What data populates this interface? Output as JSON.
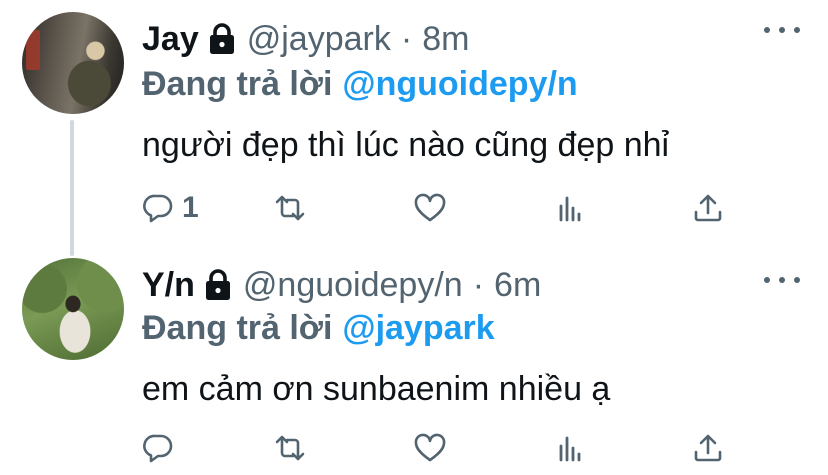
{
  "colors": {
    "text": "#0f1419",
    "secondary": "#536471",
    "accent": "#1d9bf0",
    "thread_line": "#cfd9de"
  },
  "tweets": [
    {
      "display_name": "Jay",
      "handle": "@jaypark",
      "dot": "·",
      "time": "8m",
      "reply_label": "Đang trả lời",
      "reply_to": "@nguoidepy/n",
      "text": "người đẹp thì lúc nào cũng đẹp nhỉ",
      "reply_count": "1",
      "icons": [
        "lock-icon",
        "reply-icon",
        "retweet-icon",
        "like-icon",
        "analytics-icon",
        "share-icon",
        "more-icon"
      ]
    },
    {
      "display_name": "Y/n",
      "handle": "@nguoidepy/n",
      "dot": "·",
      "time": "6m",
      "reply_label": "Đang trả lời",
      "reply_to": "@jaypark",
      "text": "em cảm ơn sunbaenim nhiều ạ",
      "reply_count": "",
      "icons": [
        "lock-icon",
        "reply-icon",
        "retweet-icon",
        "like-icon",
        "analytics-icon",
        "share-icon",
        "more-icon"
      ]
    }
  ]
}
